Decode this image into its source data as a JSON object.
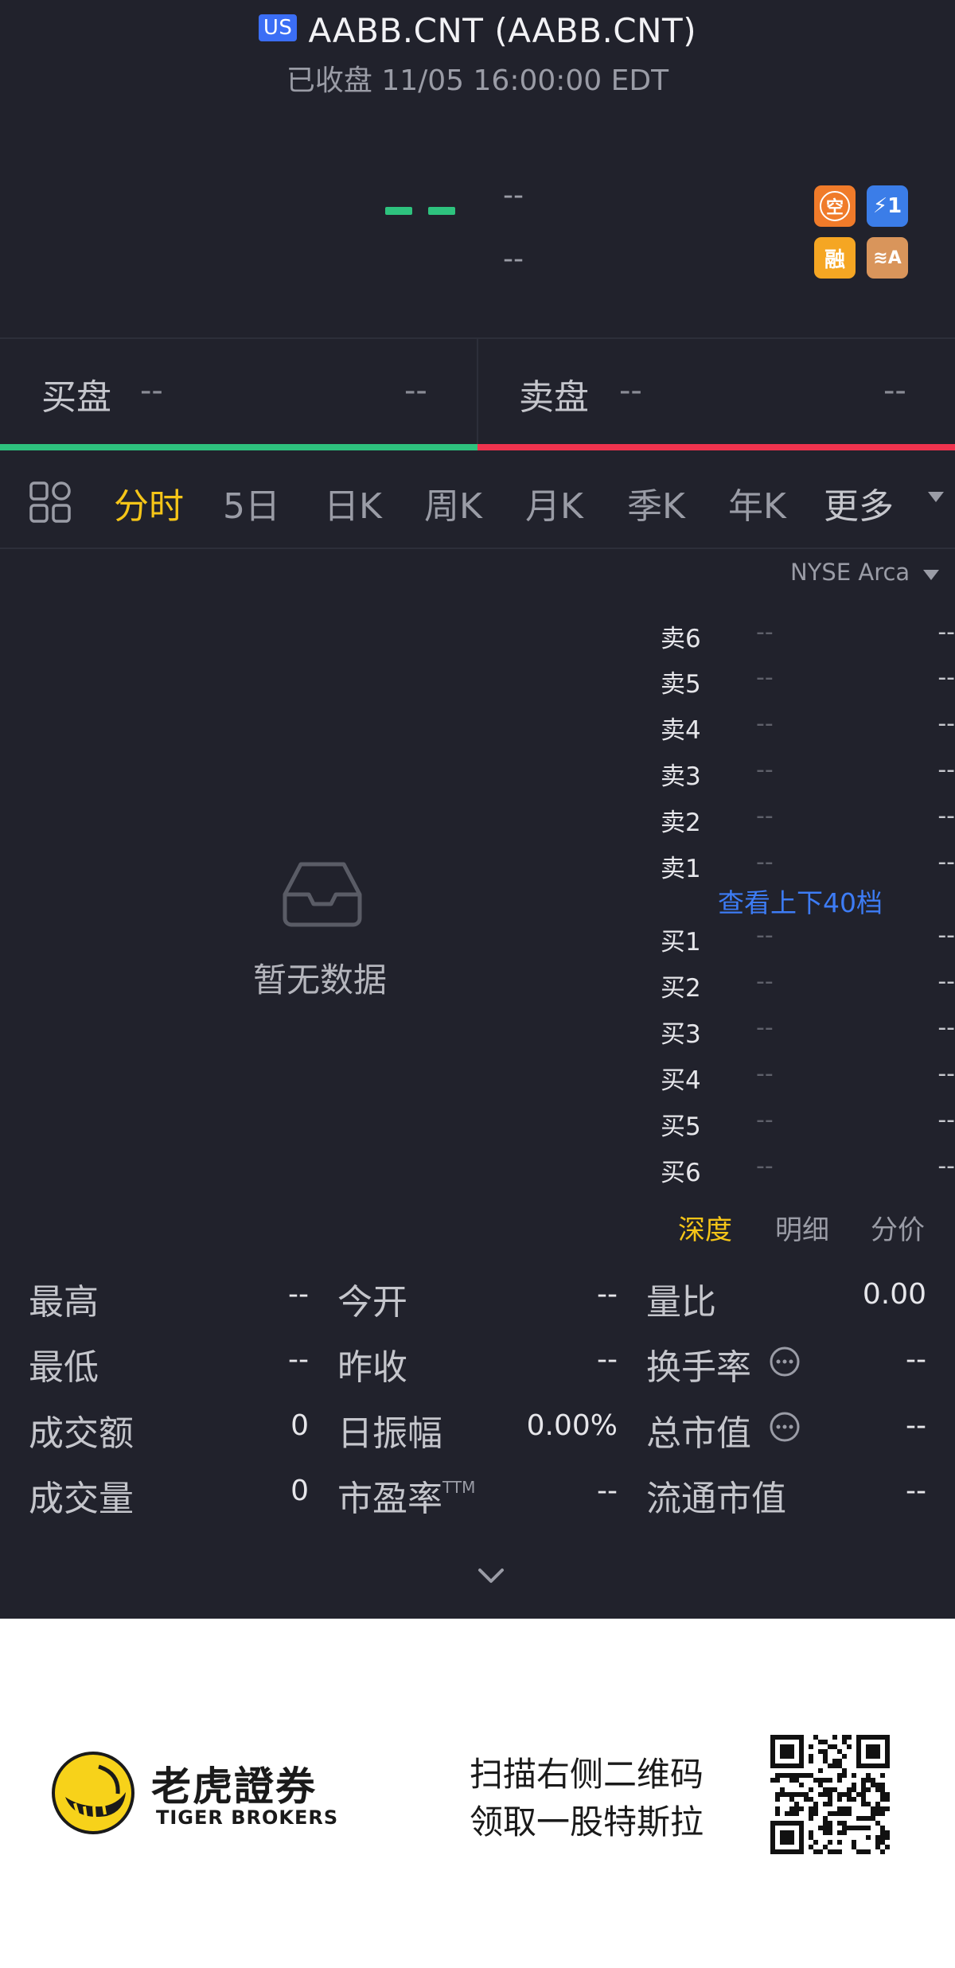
{
  "header": {
    "market_badge": "US",
    "title": "AABB.CNT (AABB.CNT)",
    "status": "已收盘 11/05 16:00:00 EDT"
  },
  "price": {
    "last": "--",
    "change": "--",
    "change_pct": "--",
    "badges": [
      {
        "icon": "short-sell-icon",
        "text": "空",
        "color": "#f07b2a"
      },
      {
        "icon": "lightning-icon",
        "text": "⚡1",
        "color": "#3b7de8"
      },
      {
        "icon": "margin-icon",
        "text": "融",
        "color": "#f5a623"
      },
      {
        "icon": "layers-icon",
        "text": "≋A",
        "color": "#d9955b"
      }
    ]
  },
  "orderbook_summary": {
    "buy_label": "买盘",
    "buy_price": "--",
    "buy_volume": "--",
    "sell_label": "卖盘",
    "sell_price": "--",
    "sell_volume": "--"
  },
  "tabs": [
    {
      "label": "分时",
      "active": true
    },
    {
      "label": "5日",
      "active": false
    },
    {
      "label": "日K",
      "active": false
    },
    {
      "label": "周K",
      "active": false
    },
    {
      "label": "月K",
      "active": false
    },
    {
      "label": "季K",
      "active": false
    },
    {
      "label": "年K",
      "active": false
    },
    {
      "label": "更多",
      "active": false
    }
  ],
  "chart": {
    "exchange": "NYSE Arca",
    "no_data": "暂无数据"
  },
  "depth": {
    "asks": [
      {
        "label": "卖6",
        "price": "--",
        "volume": "--"
      },
      {
        "label": "卖5",
        "price": "--",
        "volume": "--"
      },
      {
        "label": "卖4",
        "price": "--",
        "volume": "--"
      },
      {
        "label": "卖3",
        "price": "--",
        "volume": "--"
      },
      {
        "label": "卖2",
        "price": "--",
        "volume": "--"
      },
      {
        "label": "卖1",
        "price": "--",
        "volume": "--"
      }
    ],
    "view_more": "查看上下40档",
    "bids": [
      {
        "label": "买1",
        "price": "--",
        "volume": "--"
      },
      {
        "label": "买2",
        "price": "--",
        "volume": "--"
      },
      {
        "label": "买3",
        "price": "--",
        "volume": "--"
      },
      {
        "label": "买4",
        "price": "--",
        "volume": "--"
      },
      {
        "label": "买5",
        "price": "--",
        "volume": "--"
      },
      {
        "label": "买6",
        "price": "--",
        "volume": "--"
      }
    ],
    "subtabs": [
      {
        "label": "深度",
        "active": true
      },
      {
        "label": "明细",
        "active": false
      },
      {
        "label": "分价",
        "active": false
      }
    ]
  },
  "stats": {
    "high": {
      "label": "最高",
      "value": "--"
    },
    "open": {
      "label": "今开",
      "value": "--"
    },
    "volume_ratio": {
      "label": "量比",
      "value": "0.00"
    },
    "low": {
      "label": "最低",
      "value": "--"
    },
    "prev_close": {
      "label": "昨收",
      "value": "--"
    },
    "turnover_rate": {
      "label": "换手率",
      "value": "--"
    },
    "turnover": {
      "label": "成交额",
      "value": "0"
    },
    "amplitude": {
      "label": "日振幅",
      "value": "0.00%"
    },
    "market_cap": {
      "label": "总市值",
      "value": "--"
    },
    "volume": {
      "label": "成交量",
      "value": "0"
    },
    "pe": {
      "label": "市盈率",
      "suffix": "TTM",
      "value": "--"
    },
    "float_cap": {
      "label": "流通市值",
      "value": "--"
    }
  },
  "banner": {
    "brand_cn": "老虎證券",
    "brand_en": "TIGER BROKERS",
    "promo_line1": "扫描右侧二维码",
    "promo_line2": "领取一股特斯拉"
  }
}
